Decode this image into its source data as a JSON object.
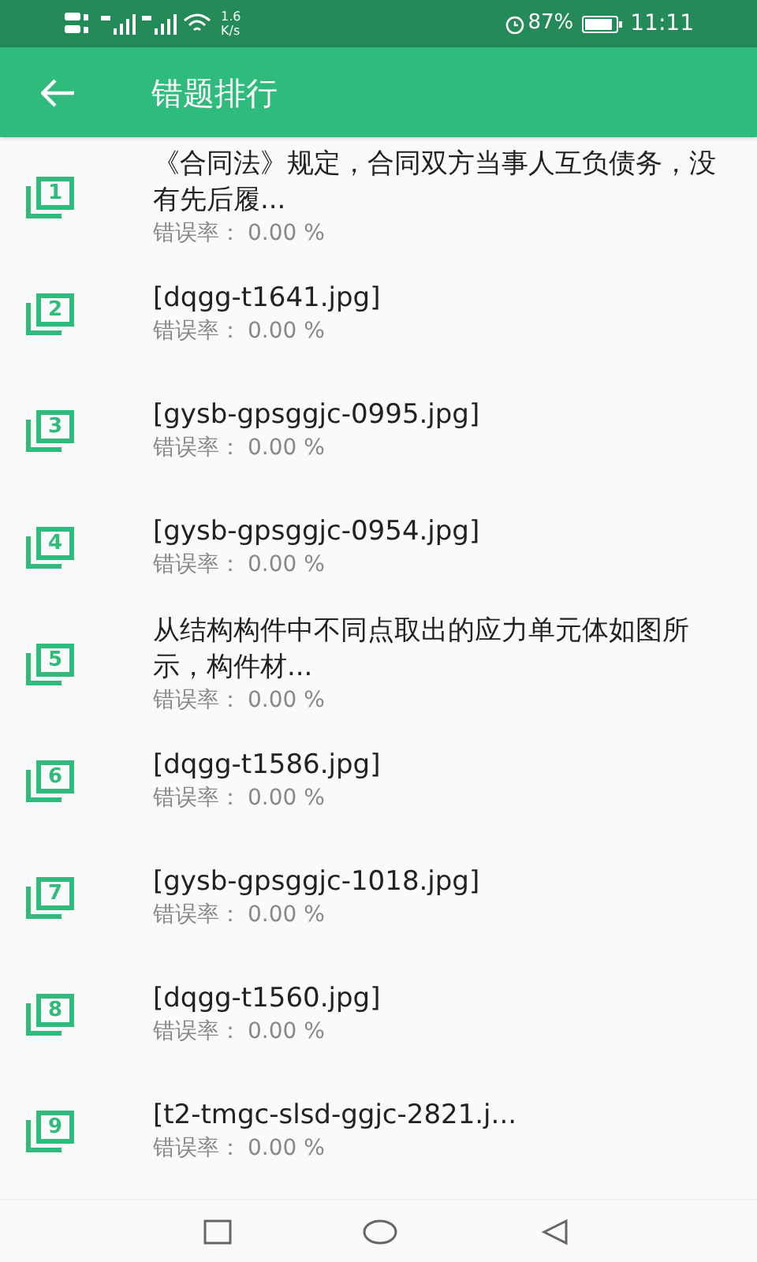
{
  "status_bar": {
    "speed_value": "1.6",
    "speed_unit": "K/s",
    "battery": "87%",
    "time": "11:11"
  },
  "toolbar": {
    "title": "错题排行"
  },
  "items": [
    {
      "number": "1",
      "title": "《合同法》规定，合同双方当事人互负债务，没有先后履...",
      "rate_label": "错误率：",
      "rate": "0.00 %"
    },
    {
      "number": "2",
      "title": "[dqgg-t1641.jpg]",
      "rate_label": "错误率：",
      "rate": "0.00 %"
    },
    {
      "number": "3",
      "title": "[gysb-gpsggjc-0995.jpg]",
      "rate_label": "错误率：",
      "rate": "0.00 %"
    },
    {
      "number": "4",
      "title": "[gysb-gpsggjc-0954.jpg]",
      "rate_label": "错误率：",
      "rate": "0.00 %"
    },
    {
      "number": "5",
      "title": "从结构构件中不同点取出的应力单元体如图所示，构件材...",
      "rate_label": "错误率：",
      "rate": "0.00 %"
    },
    {
      "number": "6",
      "title": "[dqgg-t1586.jpg]",
      "rate_label": "错误率：",
      "rate": "0.00 %"
    },
    {
      "number": "7",
      "title": "[gysb-gpsggjc-1018.jpg]",
      "rate_label": "错误率：",
      "rate": "0.00 %"
    },
    {
      "number": "8",
      "title": "[dqgg-t1560.jpg]",
      "rate_label": "错误率：",
      "rate": "0.00 %"
    },
    {
      "number": "9",
      "title": "[t2-tmgc-slsd-ggjc-2821.j...",
      "rate_label": "错误率：",
      "rate": "0.00 %"
    }
  ]
}
